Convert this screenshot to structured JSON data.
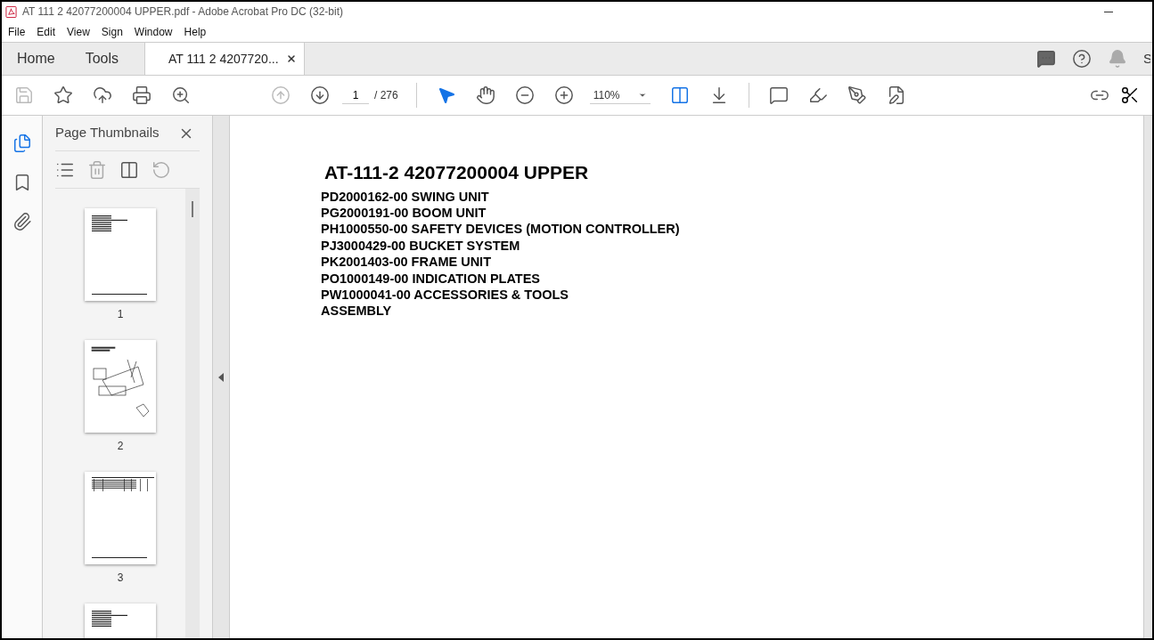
{
  "window": {
    "title": "AT 111 2 42077200004 UPPER.pdf - Adobe Acrobat Pro DC (32-bit)"
  },
  "menu": [
    "File",
    "Edit",
    "View",
    "Sign",
    "Window",
    "Help"
  ],
  "tabs": [
    {
      "label": "Home",
      "selected": false,
      "kind": "nav"
    },
    {
      "label": "Tools",
      "selected": false,
      "kind": "nav"
    },
    {
      "label": "AT 111 2 4207720...",
      "selected": true,
      "kind": "document"
    }
  ],
  "account": {
    "label": "S"
  },
  "toolbar": {
    "page_number": "1",
    "page_count": "/ 276",
    "zoom": "110%"
  },
  "sidebar": {
    "title": "Page Thumbnails"
  },
  "thumbnails": [
    {
      "kind": "text",
      "page": "1"
    },
    {
      "kind": "drawing",
      "page": "2"
    },
    {
      "kind": "table",
      "page": "3"
    },
    {
      "kind": "text"
    }
  ],
  "document": {
    "title": "AT-111-2 42077200004 UPPER",
    "lines": [
      "PD2000162-00 SWING UNIT",
      "PG2000191-00 BOOM UNIT",
      "PH1000550-00 SAFETY DEVICES (MOTION CONTROLLER)",
      "PJ3000429-00 BUCKET SYSTEM",
      "PK2001403-00 FRAME UNIT",
      "PO1000149-00 INDICATION PLATES",
      "PW1000041-00 ACCESSORIES & TOOLS",
      "ASSEMBLY"
    ]
  }
}
